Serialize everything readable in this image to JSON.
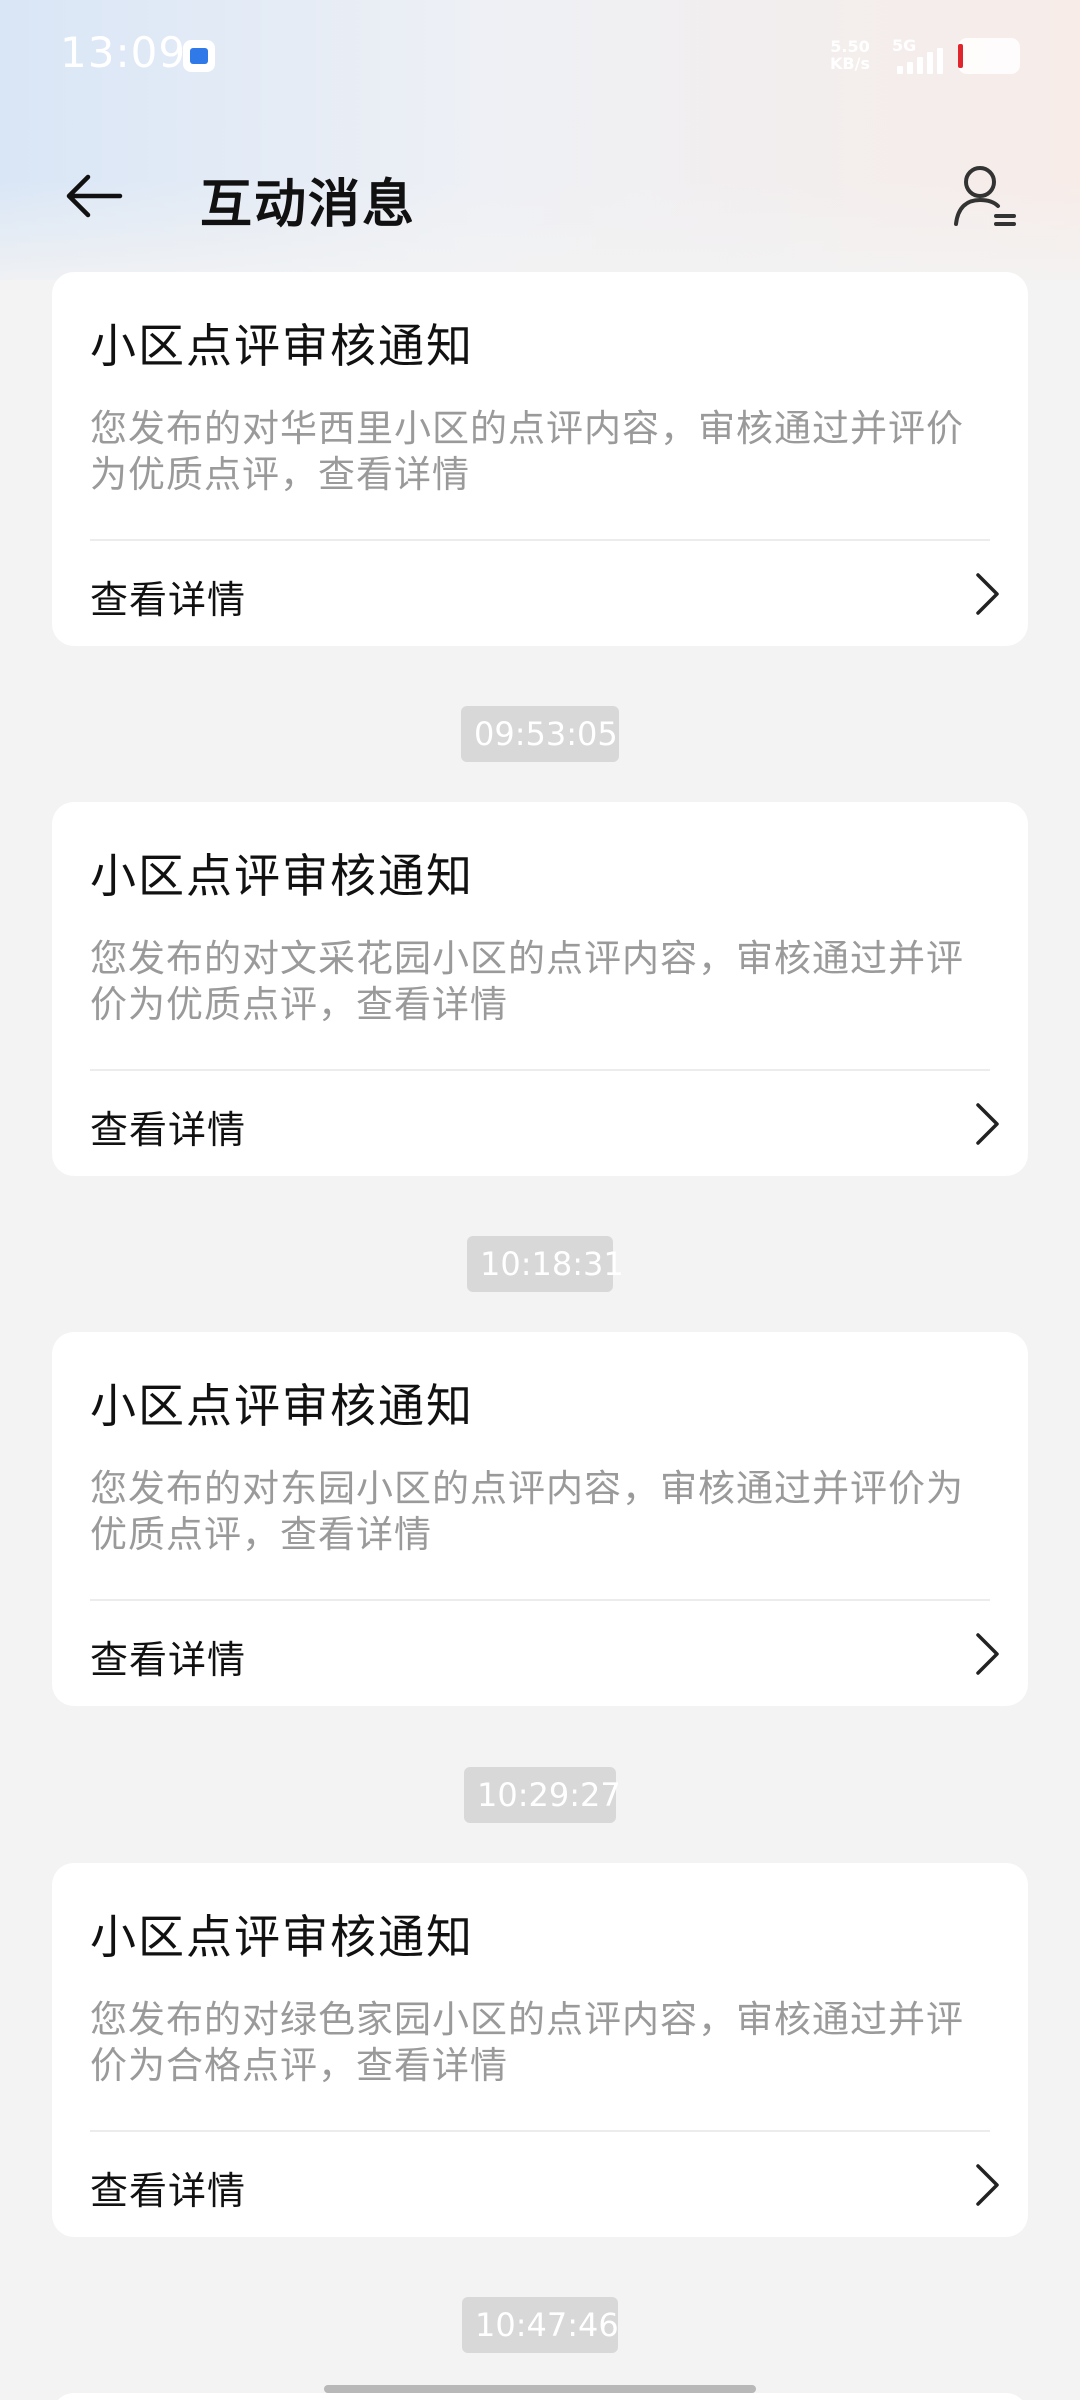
{
  "status_bar": {
    "time": "13:09",
    "speed_value": "5.50",
    "speed_unit": "KB/s",
    "network": "5G"
  },
  "header": {
    "title": "互动消息"
  },
  "messages": [
    {
      "title": "小区点评审核通知",
      "desc": "您发布的对华西里小区的点评内容，审核通过并评价为优质点评，查看详情",
      "action": "查看详情"
    },
    {
      "time": "09:53:05",
      "title": "小区点评审核通知",
      "desc": "您发布的对文采花园小区的点评内容，审核通过并评价为优质点评，查看详情",
      "action": "查看详情"
    },
    {
      "time": "10:18:31",
      "title": "小区点评审核通知",
      "desc": "您发布的对东园小区的点评内容，审核通过并评价为优质点评，查看详情",
      "action": "查看详情"
    },
    {
      "time": "10:29:27",
      "title": "小区点评审核通知",
      "desc": "您发布的对绿色家园小区的点评内容，审核通过并评价为合格点评，查看详情",
      "action": "查看详情"
    },
    {
      "time": "10:47:46"
    }
  ],
  "icons": {
    "back": "arrow-left-icon",
    "profile": "user-icon",
    "chevron": "chevron-right-icon"
  }
}
